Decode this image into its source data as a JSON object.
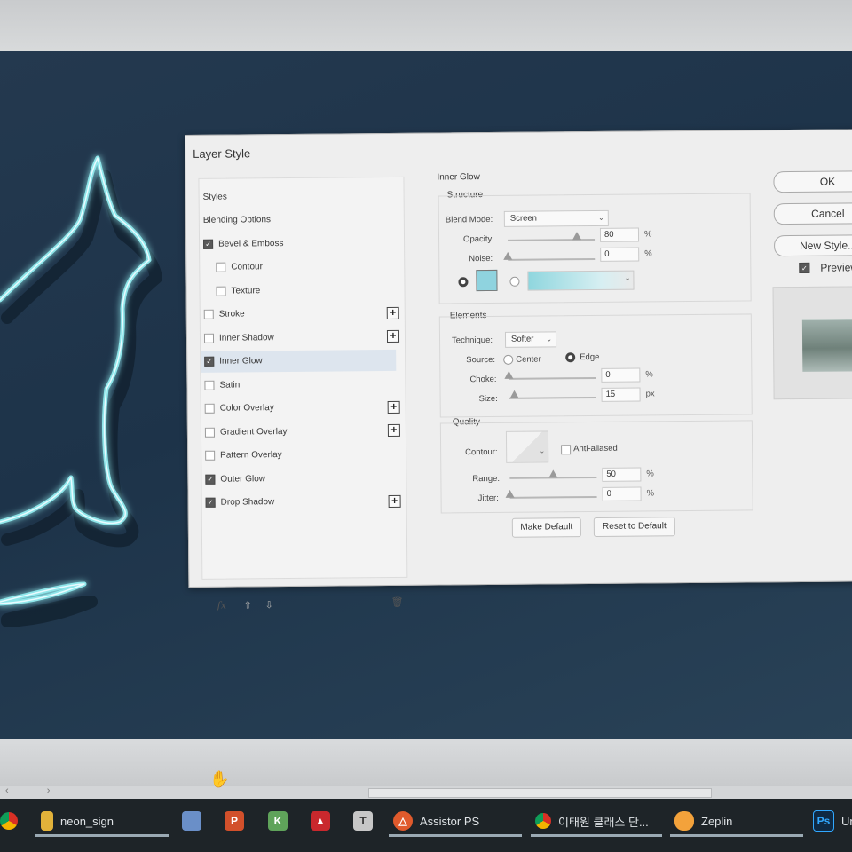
{
  "dialog": {
    "title": "Layer Style",
    "style_list": [
      {
        "label": "Styles",
        "checkbox": false,
        "checked": false,
        "plus": false,
        "selected": false,
        "indent": 0
      },
      {
        "label": "Blending Options",
        "checkbox": false,
        "checked": false,
        "plus": false,
        "selected": false,
        "indent": 0
      },
      {
        "label": "Bevel & Emboss",
        "checkbox": true,
        "checked": true,
        "plus": false,
        "selected": false,
        "indent": 0
      },
      {
        "label": "Contour",
        "checkbox": true,
        "checked": false,
        "plus": false,
        "selected": false,
        "indent": 1
      },
      {
        "label": "Texture",
        "checkbox": true,
        "checked": false,
        "plus": false,
        "selected": false,
        "indent": 1
      },
      {
        "label": "Stroke",
        "checkbox": true,
        "checked": false,
        "plus": true,
        "selected": false,
        "indent": 0
      },
      {
        "label": "Inner Shadow",
        "checkbox": true,
        "checked": false,
        "plus": true,
        "selected": false,
        "indent": 0
      },
      {
        "label": "Inner Glow",
        "checkbox": true,
        "checked": true,
        "plus": false,
        "selected": true,
        "indent": 0
      },
      {
        "label": "Satin",
        "checkbox": true,
        "checked": false,
        "plus": false,
        "selected": false,
        "indent": 0
      },
      {
        "label": "Color Overlay",
        "checkbox": true,
        "checked": false,
        "plus": true,
        "selected": false,
        "indent": 0
      },
      {
        "label": "Gradient Overlay",
        "checkbox": true,
        "checked": false,
        "plus": true,
        "selected": false,
        "indent": 0
      },
      {
        "label": "Pattern Overlay",
        "checkbox": true,
        "checked": false,
        "plus": false,
        "selected": false,
        "indent": 0
      },
      {
        "label": "Outer Glow",
        "checkbox": true,
        "checked": true,
        "plus": false,
        "selected": false,
        "indent": 0
      },
      {
        "label": "Drop Shadow",
        "checkbox": true,
        "checked": true,
        "plus": true,
        "selected": false,
        "indent": 0
      }
    ],
    "footer": {
      "fx": "fx",
      "up_icon": "arrow-up-icon",
      "down_icon": "arrow-down-icon",
      "trash_icon": "trash-icon"
    },
    "inner_glow": {
      "heading": "Inner Glow",
      "structure": {
        "title": "Structure",
        "blend_mode_label": "Blend Mode:",
        "blend_mode_value": "Screen",
        "opacity_label": "Opacity:",
        "opacity_value": "80",
        "opacity_unit": "%",
        "opacity_level": 0.8,
        "noise_label": "Noise:",
        "noise_value": "0",
        "noise_unit": "%",
        "noise_level": 0,
        "glow_color": "#8fd3df"
      },
      "elements": {
        "title": "Elements",
        "technique_label": "Technique:",
        "technique_value": "Softer",
        "source_label": "Source:",
        "source_center": "Center",
        "source_edge": "Edge",
        "choke_label": "Choke:",
        "choke_value": "0",
        "choke_unit": "%",
        "choke_level": 0,
        "size_label": "Size:",
        "size_value": "15",
        "size_unit": "px",
        "size_level": 0.06
      },
      "quality": {
        "title": "Quality",
        "contour_label": "Contour:",
        "anti_aliased_label": "Anti-aliased",
        "range_label": "Range:",
        "range_value": "50",
        "range_unit": "%",
        "range_level": 0.5,
        "jitter_label": "Jitter:",
        "jitter_value": "0",
        "jitter_unit": "%",
        "jitter_level": 0
      },
      "make_default": "Make Default",
      "reset_default": "Reset to Default"
    },
    "buttons": {
      "ok": "OK",
      "cancel": "Cancel",
      "new_style": "New Style..."
    },
    "preview_label": "Preview"
  },
  "canvas": {
    "bg_color": "#1f3449",
    "neon_color": "#8fe6ea"
  },
  "taskbar": {
    "items": [
      {
        "label": "neon_sign",
        "icon": "folder-icon"
      },
      {
        "label": "Assistor PS",
        "icon": "assistor-icon"
      },
      {
        "label": "이태원 클래스 단...",
        "icon": "chrome-icon"
      },
      {
        "label": "Zeplin",
        "icon": "zeplin-icon"
      },
      {
        "label": "Un",
        "icon": "photoshop-icon"
      }
    ],
    "ps_icon_text": "Ps",
    "t_icon_text": "T"
  }
}
